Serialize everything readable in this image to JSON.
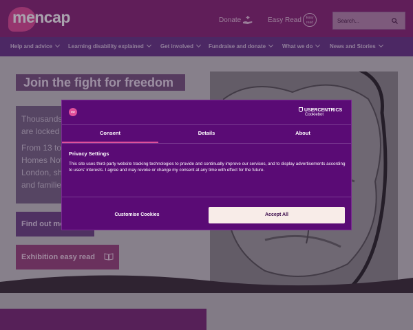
{
  "header": {
    "logo_text": "mencap",
    "donate_label": "Donate",
    "easy_read_label": "Easy Read",
    "easy_read_badge": "Easy read",
    "search_placeholder": "Search..."
  },
  "nav": {
    "items": [
      {
        "label": "Help and advice"
      },
      {
        "label": "Learning disability explained"
      },
      {
        "label": "Get involved"
      },
      {
        "label": "Fundraise and donate"
      },
      {
        "label": "What we do"
      },
      {
        "label": "News and Stories"
      }
    ]
  },
  "hero": {
    "title": "Join the fight for freedom",
    "body_lines": [
      "Thousands",
      "are locked",
      "From 13 to",
      "Homes Not",
      "London, sh",
      "and familie"
    ],
    "find_out_label": "Find out mo",
    "easy_read_button_label": "Exhibition easy read"
  },
  "consent": {
    "brand_logo_text": "me",
    "provider_name": "USERCENTRICS",
    "provider_sub": "Cookiebot",
    "tabs": [
      {
        "label": "Consent",
        "active": true
      },
      {
        "label": "Details",
        "active": false
      },
      {
        "label": "About",
        "active": false
      }
    ],
    "heading": "Privacy Settings",
    "body": "This site uses third-party website tracking technologies to provide and continually improve our services, and to display advertisements according to users' interests. I agree and may revoke or change my consent at any time with effect for the future.",
    "customise_label": "Customise Cookies",
    "accept_label": "Accept All"
  },
  "colors": {
    "header_bg": "#8a2a78",
    "nav_bg": "#6a3a8a",
    "modal_bg": "#5a0b75",
    "accent_pink": "#e0509a",
    "accept_bg": "#f8ece8"
  }
}
